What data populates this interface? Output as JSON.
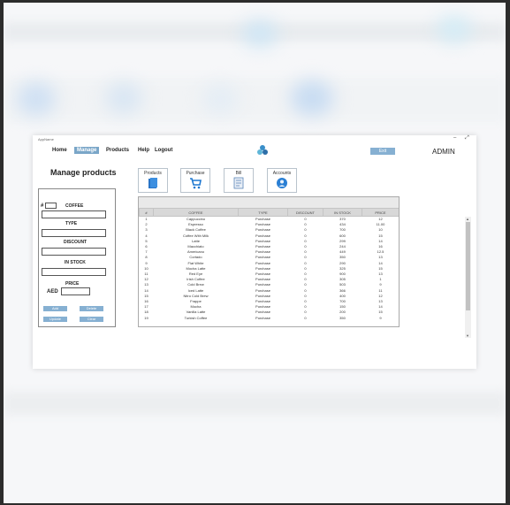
{
  "app": {
    "title": "AppName",
    "window_controls": [
      "–",
      "⤢"
    ]
  },
  "nav": {
    "items": [
      "Home",
      "Manage",
      "Products",
      "Help",
      "Logout"
    ],
    "active": "Manage"
  },
  "header": {
    "exit_label": "Exit",
    "user": "ADMIN"
  },
  "page": {
    "title": "Manage products"
  },
  "categories": [
    {
      "label": "Products",
      "icon": "book-icon"
    },
    {
      "label": "Purchase",
      "icon": "cart-icon"
    },
    {
      "label": "Bill",
      "icon": "bill-icon"
    },
    {
      "label": "Accounts",
      "icon": "account-icon"
    }
  ],
  "form": {
    "hash": "#",
    "coffee_label": "COFFEE",
    "type_label": "TYPE",
    "discount_label": "DISCOUNT",
    "stock_label": "IN STOCK",
    "price_label": "PRICE",
    "currency": "AED",
    "buttons": {
      "add": "Add",
      "delete": "Delete",
      "update": "Update",
      "clear": "Clear"
    }
  },
  "table": {
    "columns": [
      "#",
      "COFFEE",
      "TYPE",
      "DISCOUNT",
      "IN STOCK",
      "PRICE"
    ],
    "rows": [
      [
        "1",
        "Cappuccino",
        "Purchase",
        "0",
        "370",
        "12"
      ],
      [
        "2",
        "Espresso",
        "Purchase",
        "0",
        "434",
        "11.00"
      ],
      [
        "3",
        "Black Coffee",
        "Purchase",
        "0",
        "700",
        "10"
      ],
      [
        "4",
        "Coffee With Milk",
        "Purchase",
        "0",
        "600",
        "15"
      ],
      [
        "5",
        "Latte",
        "Purchase",
        "0",
        "299",
        "14"
      ],
      [
        "6",
        "Macchiato",
        "Purchase",
        "0",
        "244",
        "16"
      ],
      [
        "7",
        "Americano",
        "Purchase",
        "0",
        "449",
        "12.5"
      ],
      [
        "8",
        "Cortado",
        "Purchase",
        "0",
        "350",
        "13"
      ],
      [
        "9",
        "Flat White",
        "Purchase",
        "0",
        "290",
        "14"
      ],
      [
        "10",
        "Mocha Latte",
        "Purchase",
        "0",
        "325",
        "15"
      ],
      [
        "11",
        "Red Eye",
        "Purchase",
        "0",
        "900",
        "13"
      ],
      [
        "12",
        "Irish Coffee",
        "Purchase",
        "0",
        "305",
        "1"
      ],
      [
        "13",
        "Cold Brew",
        "Purchase",
        "0",
        "503",
        "9"
      ],
      [
        "14",
        "Iced Latte",
        "Purchase",
        "0",
        "366",
        "11"
      ],
      [
        "15",
        "Nitro Cold Brew",
        "Purchase",
        "0",
        "400",
        "12"
      ],
      [
        "16",
        "Frappe",
        "Purchase",
        "0",
        "700",
        "13"
      ],
      [
        "17",
        "Mocha",
        "Purchase",
        "0",
        "150",
        "14"
      ],
      [
        "18",
        "Vanilla Latte",
        "Purchase",
        "0",
        "200",
        "15"
      ],
      [
        "19",
        "Turkish Coffee",
        "Purchase",
        "0",
        "350",
        "9"
      ]
    ]
  },
  "colors": {
    "accent": "#86b0d2",
    "active_nav": "#7aa6c8"
  }
}
